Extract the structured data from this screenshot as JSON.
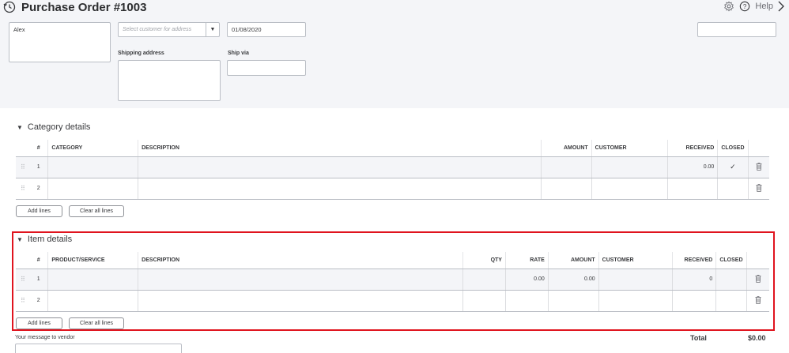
{
  "header": {
    "title": "Purchase Order #1003",
    "help_label": "Help"
  },
  "form": {
    "vendor_value": "Alex",
    "customer_placeholder": "Select customer for address",
    "date_value": "01/08/2020",
    "shipping_address_label": "Shipping address",
    "ship_via_label": "Ship via"
  },
  "category_details": {
    "title": "Category details",
    "columns": {
      "num": "#",
      "category": "CATEGORY",
      "description": "DESCRIPTION",
      "amount": "AMOUNT",
      "customer": "CUSTOMER",
      "received": "RECEIVED",
      "closed": "CLOSED"
    },
    "rows": [
      {
        "num": "1",
        "received": "0.00",
        "closed": "✓"
      },
      {
        "num": "2"
      }
    ],
    "add_lines_label": "Add lines",
    "clear_lines_label": "Clear all lines"
  },
  "item_details": {
    "title": "Item details",
    "columns": {
      "num": "#",
      "product": "PRODUCT/SERVICE",
      "description": "DESCRIPTION",
      "qty": "QTY",
      "rate": "RATE",
      "amount": "AMOUNT",
      "customer": "CUSTOMER",
      "received": "RECEIVED",
      "closed": "CLOSED"
    },
    "rows": [
      {
        "num": "1",
        "rate": "0.00",
        "amount": "0.00",
        "received": "0"
      },
      {
        "num": "2"
      }
    ],
    "add_lines_label": "Add lines",
    "clear_lines_label": "Clear all lines"
  },
  "footer": {
    "message_label": "Your message to vendor",
    "total_label": "Total",
    "total_value": "$0.00"
  },
  "icons": {
    "history": "history-icon",
    "settings": "gear-icon",
    "help": "help-circle-icon",
    "close": "chevron-right-icon",
    "drag": "drag-handle-icon",
    "delete": "trash-icon"
  },
  "colors": {
    "accent_green": "#2ca01c",
    "highlight_red": "#e0141e",
    "panel_bg": "#f4f5f8"
  }
}
